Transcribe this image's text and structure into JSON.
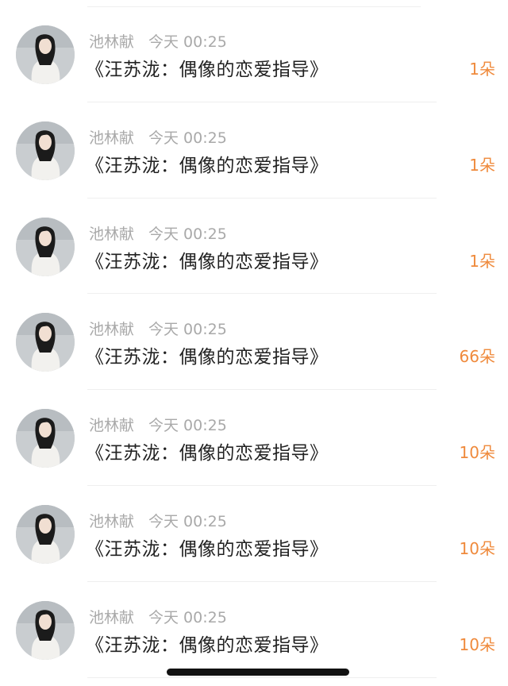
{
  "records": [
    {
      "name": "池林献",
      "time": "今天 00:25",
      "title": "《汪苏泷：偶像的恋爱指导》",
      "amount": "1朵"
    },
    {
      "name": "池林献",
      "time": "今天 00:25",
      "title": "《汪苏泷：偶像的恋爱指导》",
      "amount": "1朵"
    },
    {
      "name": "池林献",
      "time": "今天 00:25",
      "title": "《汪苏泷：偶像的恋爱指导》",
      "amount": "1朵"
    },
    {
      "name": "池林献",
      "time": "今天 00:25",
      "title": "《汪苏泷：偶像的恋爱指导》",
      "amount": "66朵"
    },
    {
      "name": "池林献",
      "time": "今天 00:25",
      "title": "《汪苏泷：偶像的恋爱指导》",
      "amount": "10朵"
    },
    {
      "name": "池林献",
      "time": "今天 00:25",
      "title": "《汪苏泷：偶像的恋爱指导》",
      "amount": "10朵"
    },
    {
      "name": "池林献",
      "time": "今天 00:25",
      "title": "《汪苏泷：偶像的恋爱指导》",
      "amount": "10朵"
    }
  ],
  "icons": {
    "avatar": "user-avatar-photo"
  },
  "colors": {
    "amount": "#ef8a3c",
    "meta": "#a9a9a9",
    "title": "#222222"
  }
}
